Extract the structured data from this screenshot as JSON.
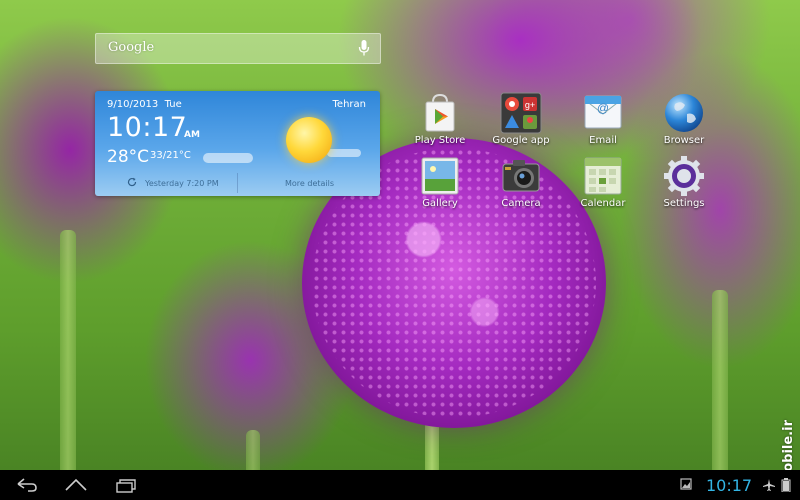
{
  "search": {
    "logo": "Google"
  },
  "weather": {
    "date": "9/10/2013",
    "day": "Tue",
    "city": "Tehran",
    "time": "10:17",
    "ampm": "AM",
    "temp": "28°C",
    "range": "33/21°C",
    "updated": "Yesterday 7:20 PM",
    "more": "More details",
    "condition_icon": "sunny-icon"
  },
  "apps": [
    {
      "label": "Play Store",
      "icon": "play-store-icon"
    },
    {
      "label": "Google app",
      "icon": "google-apps-folder-icon"
    },
    {
      "label": "Email",
      "icon": "email-icon"
    },
    {
      "label": "Browser",
      "icon": "browser-globe-icon"
    },
    {
      "label": "Gallery",
      "icon": "gallery-icon"
    },
    {
      "label": "Camera",
      "icon": "camera-icon"
    },
    {
      "label": "Calendar",
      "icon": "calendar-icon"
    },
    {
      "label": "Settings",
      "icon": "settings-gear-icon"
    }
  ],
  "statusbar": {
    "time": "10:17"
  },
  "watermark": "mobile.ir",
  "colors": {
    "clock": "#33b5e5",
    "navbar": "#000000",
    "weather_top": "#2f86d9"
  }
}
